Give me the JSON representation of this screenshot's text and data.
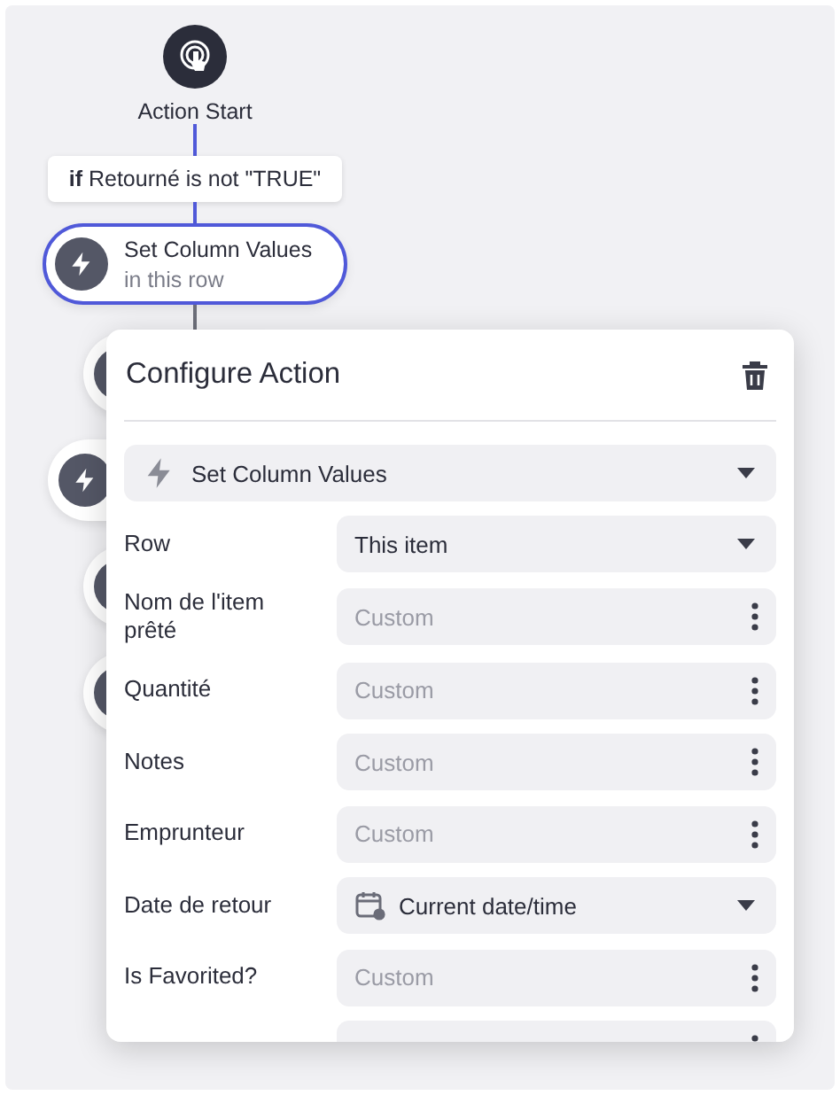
{
  "flow": {
    "start": {
      "label": "Action Start"
    },
    "condition": {
      "keyword": "if",
      "text": "Retourné is not \"TRUE\""
    },
    "step": {
      "title": "Set Column Values",
      "subtitle": "in this row",
      "selected": true
    },
    "hidden_steps": [
      {
        "kind": "nested"
      },
      {
        "kind": "action"
      },
      {
        "kind": "nested"
      },
      {
        "kind": "nested"
      }
    ]
  },
  "panel": {
    "title": "Configure Action",
    "action": {
      "label": "Set Column Values"
    },
    "rows": [
      {
        "label": "Row",
        "kind": "dropdown",
        "value": "This item"
      },
      {
        "label": "Nom de l'item prêté",
        "kind": "custom",
        "placeholder": "Custom"
      },
      {
        "label": "Quantité",
        "kind": "custom",
        "placeholder": "Custom"
      },
      {
        "label": "Notes",
        "kind": "custom",
        "placeholder": "Custom"
      },
      {
        "label": "Emprunteur",
        "kind": "custom",
        "placeholder": "Custom"
      },
      {
        "label": "Date de retour",
        "kind": "date",
        "value": "Current date/time"
      },
      {
        "label": "Is Favorited?",
        "kind": "custom",
        "placeholder": "Custom"
      },
      {
        "kind": "custom"
      }
    ]
  }
}
